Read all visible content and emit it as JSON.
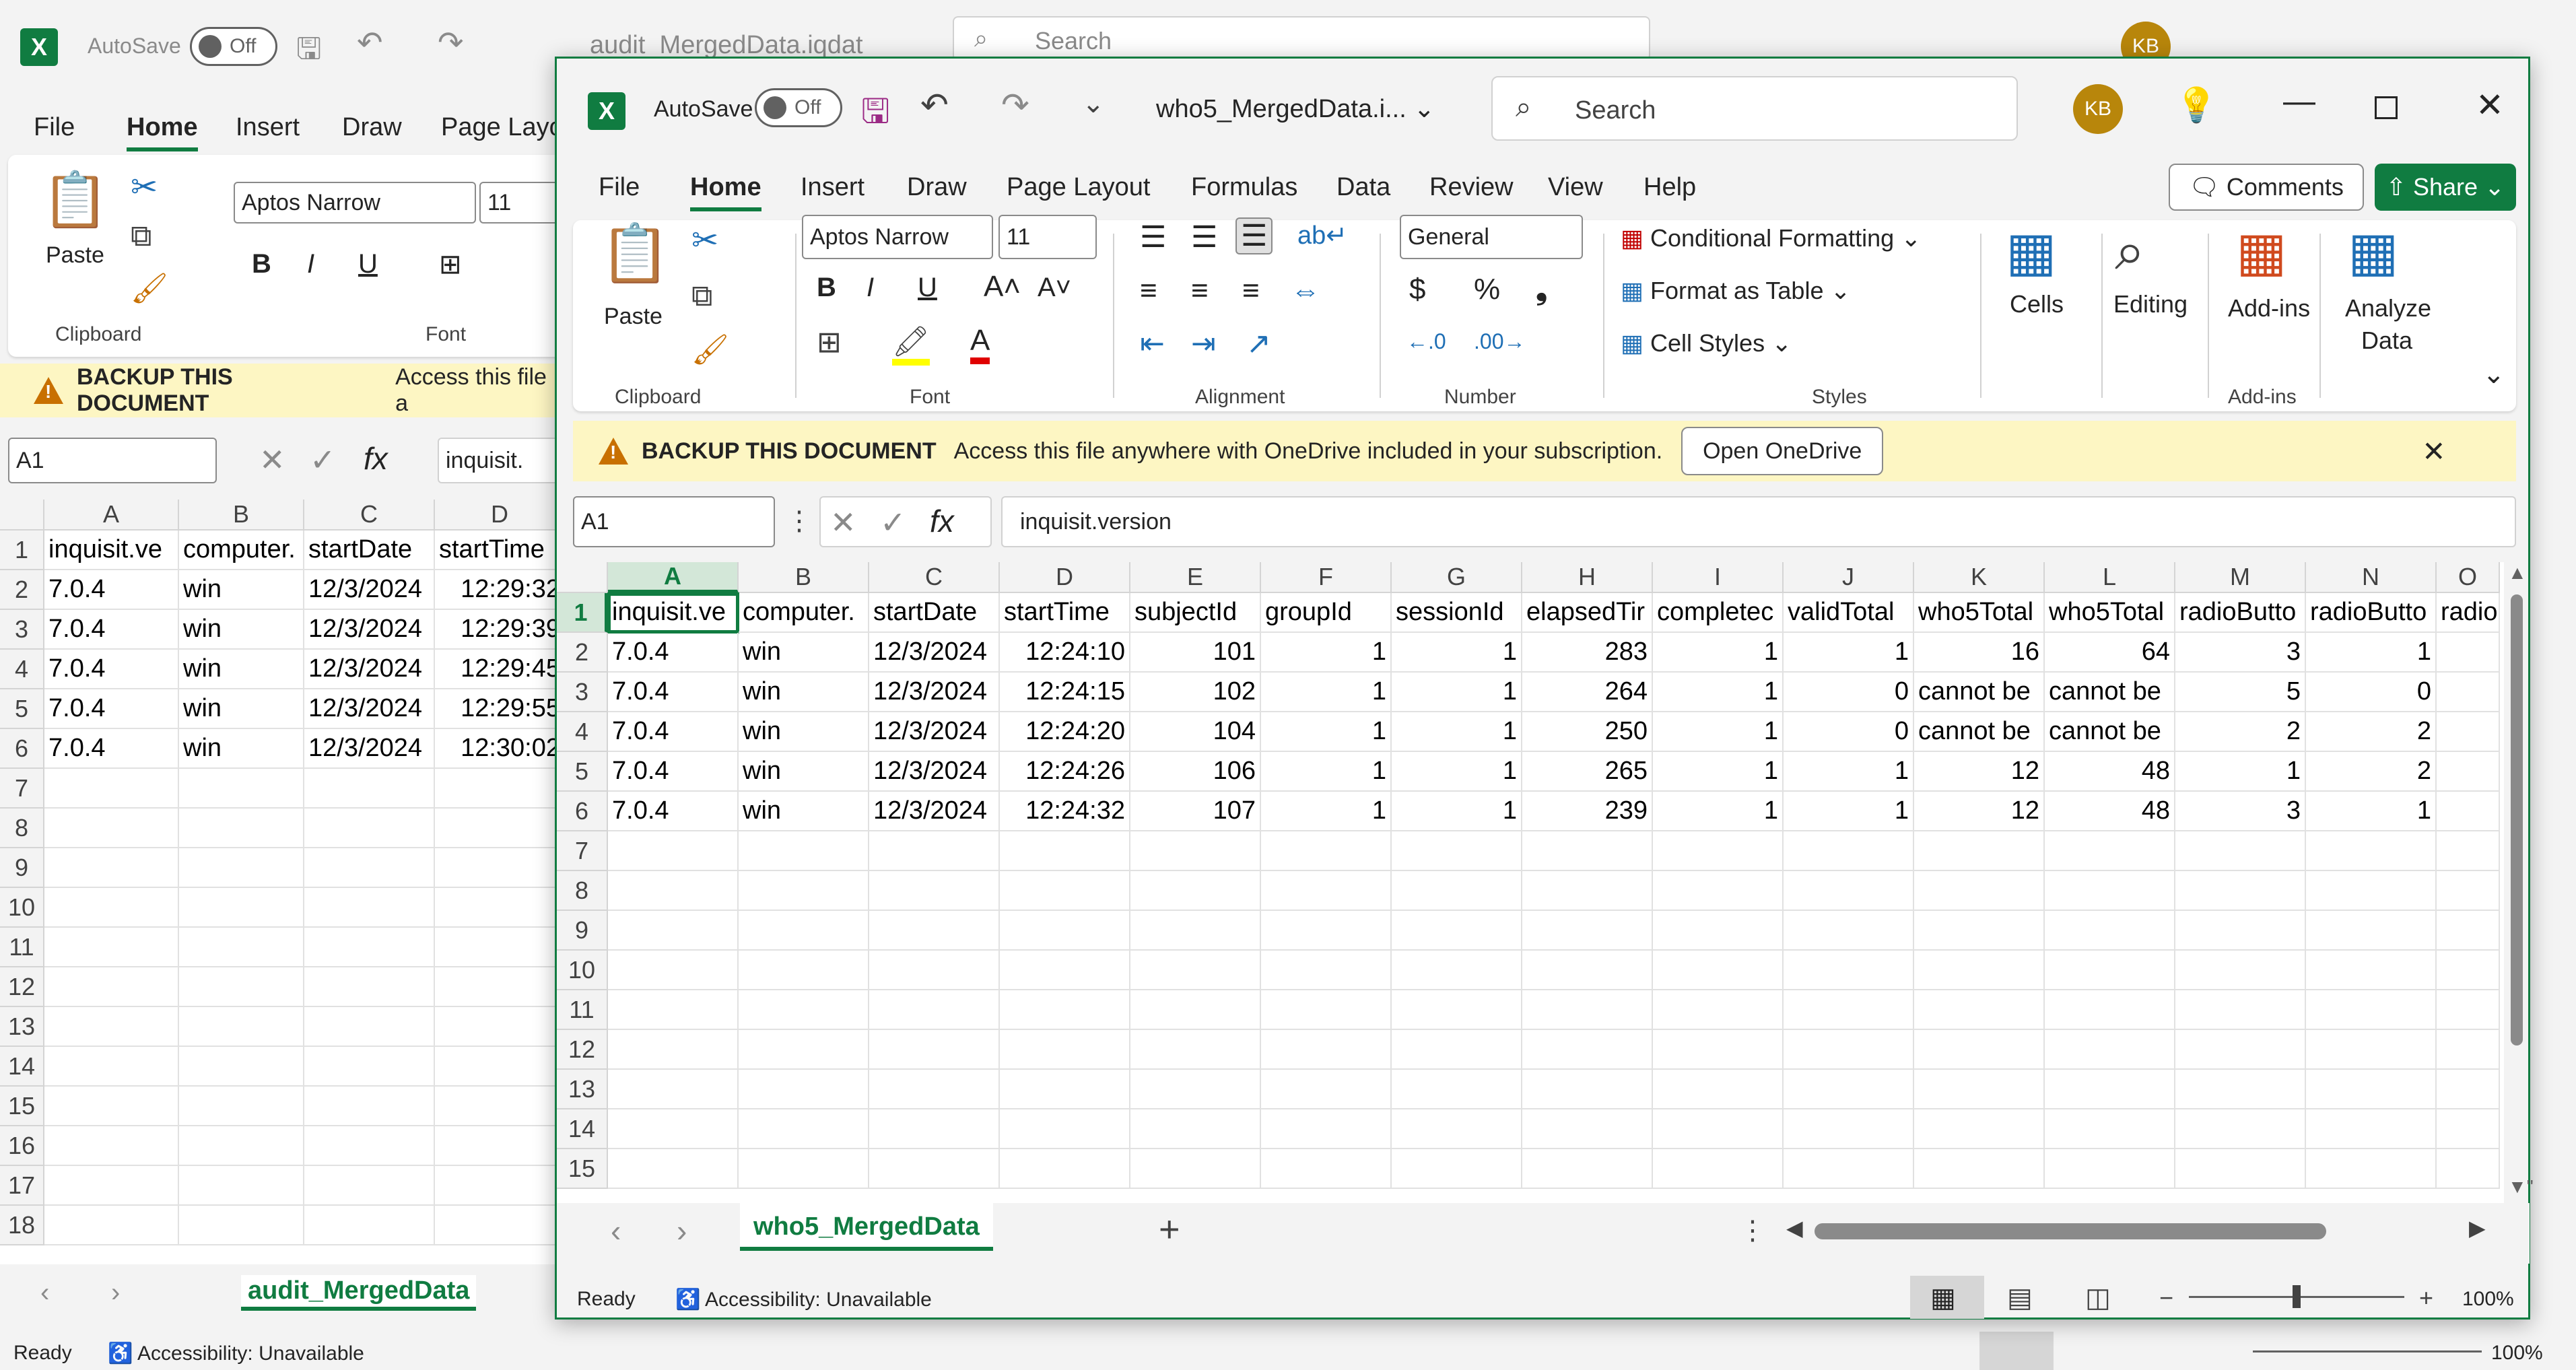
{
  "back_window": {
    "autosave_label": "AutoSave",
    "autosave_state": "Off",
    "file_name": "audit_MergedData.iqdat",
    "search_placeholder": "Search",
    "user_initials": "KB",
    "menu": [
      "File",
      "Home",
      "Insert",
      "Draw",
      "Page Layo"
    ],
    "font_name": "Aptos Narrow",
    "font_size": "11",
    "paste_label": "Paste",
    "clipboard_label": "Clipboard",
    "font_group_label": "Font",
    "banner_title": "BACKUP THIS DOCUMENT",
    "banner_text": "Access this file a",
    "name_box": "A1",
    "formula": "inquisit.",
    "columns": [
      "A",
      "B",
      "C",
      "D"
    ],
    "rows": [
      [
        "inquisit.ve",
        "computer.",
        "startDate",
        "startTime"
      ],
      [
        "7.0.4",
        "win",
        "12/3/2024",
        "12:29:32"
      ],
      [
        "7.0.4",
        "win",
        "12/3/2024",
        "12:29:39"
      ],
      [
        "7.0.4",
        "win",
        "12/3/2024",
        "12:29:45"
      ],
      [
        "7.0.4",
        "win",
        "12/3/2024",
        "12:29:55"
      ],
      [
        "7.0.4",
        "win",
        "12/3/2024",
        "12:30:02"
      ]
    ],
    "row_numbers": [
      "1",
      "2",
      "3",
      "4",
      "5",
      "6",
      "7",
      "8",
      "9",
      "10",
      "11",
      "12",
      "13",
      "14",
      "15",
      "16",
      "17",
      "18"
    ],
    "sheet_tab": "audit_MergedData",
    "status": "Ready",
    "accessibility": "Accessibility: Unavailable",
    "zoom": "100%"
  },
  "front_window": {
    "autosave_label": "AutoSave",
    "autosave_state": "Off",
    "file_name": "who5_MergedData.i...",
    "search_placeholder": "Search",
    "user_initials": "KB",
    "menu": [
      "File",
      "Home",
      "Insert",
      "Draw",
      "Page Layout",
      "Formulas",
      "Data",
      "Review",
      "View",
      "Help"
    ],
    "comments_label": "Comments",
    "share_label": "Share",
    "ribbon": {
      "paste_label": "Paste",
      "clipboard_label": "Clipboard",
      "font_name": "Aptos Narrow",
      "font_size": "11",
      "font_label": "Font",
      "alignment_label": "Alignment",
      "number_format": "General",
      "number_label": "Number",
      "conditional_formatting": "Conditional Formatting",
      "format_as_table": "Format as Table",
      "cell_styles": "Cell Styles",
      "styles_label": "Styles",
      "cells_label": "Cells",
      "editing_label": "Editing",
      "addins_label": "Add-ins",
      "addins_group_label": "Add-ins",
      "analyze_label_1": "Analyze",
      "analyze_label_2": "Data"
    },
    "banner_title": "BACKUP THIS DOCUMENT",
    "banner_text": "Access this file anywhere with OneDrive included in your subscription.",
    "banner_button": "Open OneDrive",
    "name_box": "A1",
    "formula": "inquisit.version",
    "columns": [
      "A",
      "B",
      "C",
      "D",
      "E",
      "F",
      "G",
      "H",
      "I",
      "J",
      "K",
      "L",
      "M",
      "N",
      "O"
    ],
    "header_row": [
      "inquisit.ve",
      "computer.",
      "startDate",
      "startTime",
      "subjectId",
      "groupId",
      "sessionId",
      "elapsedTir",
      "completec",
      "validTotal",
      "who5Total",
      "who5Total",
      "radioButto",
      "radioButto",
      "radio"
    ],
    "data_rows": [
      [
        "7.0.4",
        "win",
        "12/3/2024",
        "12:24:10",
        "101",
        "1",
        "1",
        "283",
        "1",
        "1",
        "16",
        "64",
        "3",
        "1",
        ""
      ],
      [
        "7.0.4",
        "win",
        "12/3/2024",
        "12:24:15",
        "102",
        "1",
        "1",
        "264",
        "1",
        "0",
        "cannot be",
        "cannot be",
        "5",
        "0",
        ""
      ],
      [
        "7.0.4",
        "win",
        "12/3/2024",
        "12:24:20",
        "104",
        "1",
        "1",
        "250",
        "1",
        "0",
        "cannot be",
        "cannot be",
        "2",
        "2",
        ""
      ],
      [
        "7.0.4",
        "win",
        "12/3/2024",
        "12:24:26",
        "106",
        "1",
        "1",
        "265",
        "1",
        "1",
        "12",
        "48",
        "1",
        "2",
        ""
      ],
      [
        "7.0.4",
        "win",
        "12/3/2024",
        "12:24:32",
        "107",
        "1",
        "1",
        "239",
        "1",
        "1",
        "12",
        "48",
        "3",
        "1",
        ""
      ]
    ],
    "row_numbers": [
      "1",
      "2",
      "3",
      "4",
      "5",
      "6",
      "7",
      "8",
      "9",
      "10",
      "11",
      "12",
      "13",
      "14",
      "15"
    ],
    "sheet_tab": "who5_MergedData",
    "status": "Ready",
    "accessibility": "Accessibility: Unavailable",
    "zoom": "100%"
  }
}
